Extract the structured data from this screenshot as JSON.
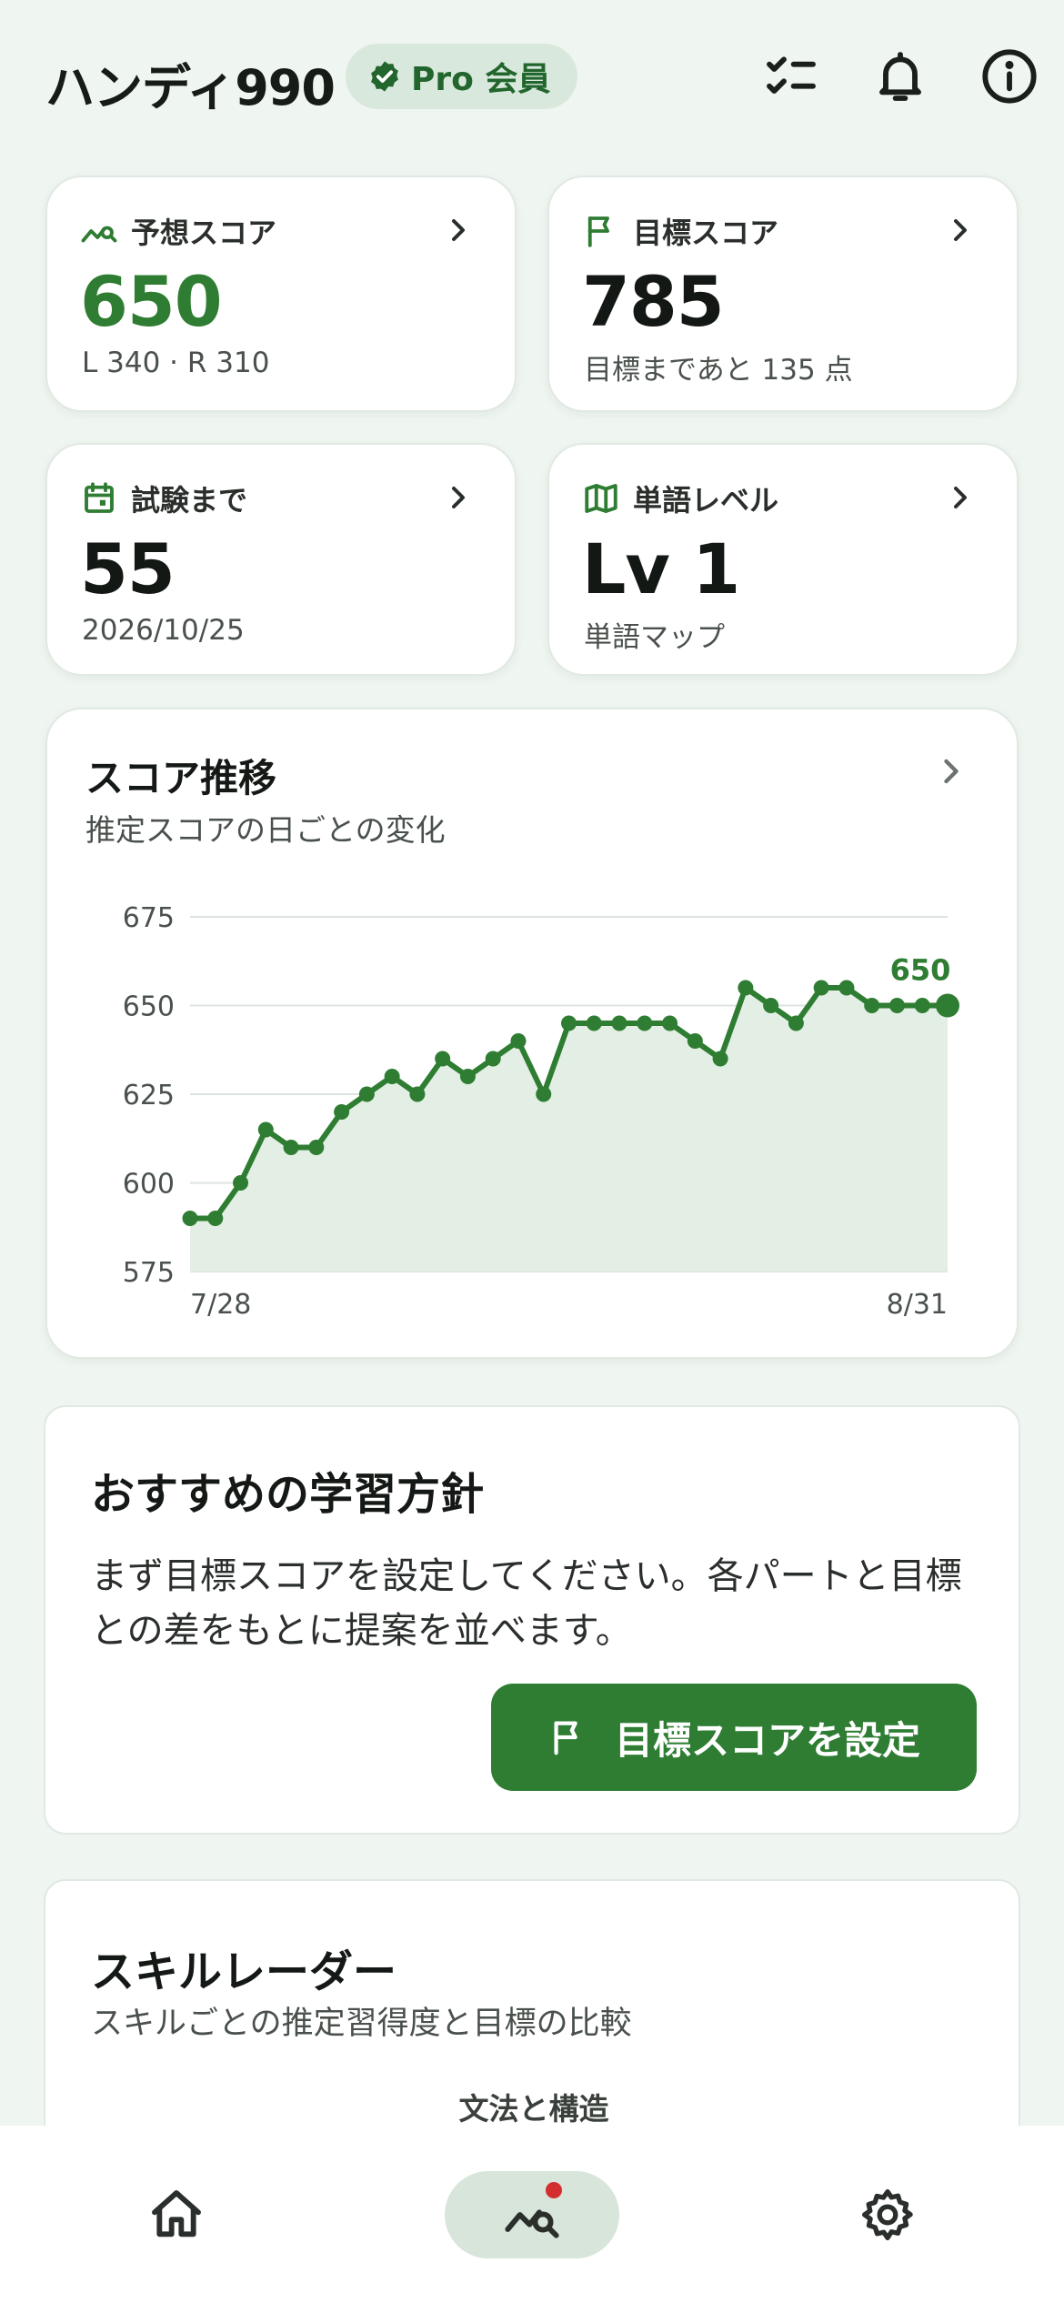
{
  "header": {
    "app_title": "ハンディ990",
    "pro_badge_label": "Pro 会員"
  },
  "stats": {
    "predicted": {
      "label": "予想スコア",
      "value": "650",
      "sub": "L 340 · R 310"
    },
    "target": {
      "label": "目標スコア",
      "value": "785",
      "sub": "目標まであと 135 点"
    },
    "exam": {
      "label": "試験まで",
      "value": "55",
      "sub": "2026/10/25"
    },
    "vocab": {
      "label": "単語レベル",
      "value": "Lv 1",
      "sub": "単語マップ"
    }
  },
  "score_trend": {
    "title": "スコア推移",
    "subtitle": "推定スコアの日ごとの変化"
  },
  "chart_data": {
    "type": "area",
    "x_start_label": "7/28",
    "x_end_label": "8/31",
    "ylim": [
      575,
      675
    ],
    "yticks": [
      675,
      650,
      625,
      600,
      575
    ],
    "grid": true,
    "last_value_label": "650",
    "values": [
      590,
      590,
      600,
      615,
      610,
      610,
      620,
      625,
      630,
      625,
      635,
      630,
      635,
      640,
      625,
      645,
      645,
      645,
      645,
      645,
      640,
      635,
      655,
      650,
      645,
      655,
      655,
      650,
      650,
      650,
      650
    ],
    "colors": {
      "line": "#2e7d32",
      "fill": "#e3eee4",
      "grid": "#dde3de",
      "tick": "#4a514c"
    }
  },
  "recommendation": {
    "title": "おすすめの学習方針",
    "body": "まず目標スコアを設定してください。各パートと目標との差をもとに提案を並べます。",
    "button_label": "目標スコアを設定"
  },
  "skill_radar": {
    "title": "スキルレーダー",
    "subtitle": "スキルごとの推定習得度と目標の比較",
    "top_axis_label": "文法と構造"
  },
  "nav": {
    "items": [
      {
        "name": "home",
        "icon": "home-icon",
        "active": false
      },
      {
        "name": "analytics",
        "icon": "analytics-icon",
        "active": true
      },
      {
        "name": "settings",
        "icon": "gear-icon",
        "active": false
      }
    ]
  },
  "colors": {
    "accent": "#2e7d32",
    "background": "#eff5f0",
    "badge_bg": "#d9e8dc",
    "notification_dot": "#d32f2f"
  }
}
